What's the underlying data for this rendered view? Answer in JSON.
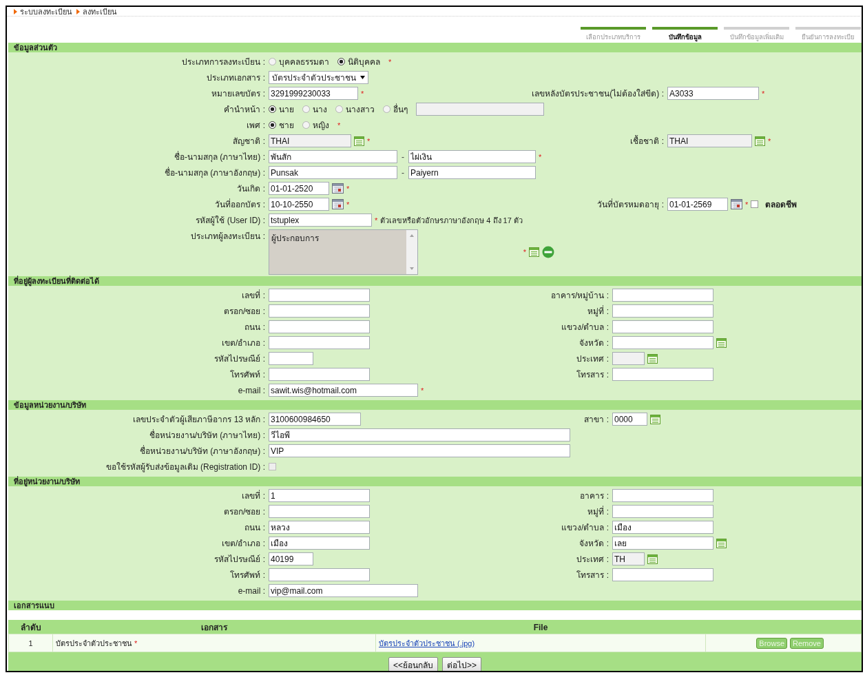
{
  "breadcrumb": [
    {
      "label": "ระบบลงทะเบียน"
    },
    {
      "label": "ลงทะเบียน"
    }
  ],
  "steps": [
    {
      "label": "เลือกประเภทบริการ",
      "done": true,
      "selected": false
    },
    {
      "label": "บันทึกข้อมูล",
      "done": true,
      "selected": true
    },
    {
      "label": "บันทึกข้อมูลเพิ่มเติม",
      "done": false,
      "selected": false
    },
    {
      "label": "ยืนยันการลงทะเบีย",
      "done": false,
      "selected": false
    }
  ],
  "sections": [
    {
      "kind": "personal",
      "title": "ข้อมูลส่วนตัว",
      "rows": [
        {
          "left": {
            "label": "ประเภทการลงทะเบียน :",
            "controls": [
              {
                "kind": "radio",
                "label": "บุคคลธรรมดา",
                "selected": false
              },
              {
                "kind": "radio",
                "label": "นิติบุคคล",
                "selected": true
              },
              {
                "kind": "required",
                "text": "*"
              }
            ]
          }
        },
        {
          "left": {
            "label": "ประเภทเอกสาร :",
            "controls": [
              {
                "kind": "select",
                "value": "บัตรประจำตัวประชาชน"
              }
            ]
          }
        },
        {
          "left": {
            "label": "หมายเลขบัตร :",
            "controls": [
              {
                "kind": "text",
                "value": "3291999230033"
              },
              {
                "kind": "required",
                "text": "*"
              }
            ]
          },
          "right": {
            "label": "เลขหลังบัตรประชาชน(ไม่ต้องใส่ขีด) :",
            "controls": [
              {
                "kind": "text",
                "value": "A3033"
              },
              {
                "kind": "required",
                "text": "*"
              }
            ]
          }
        },
        {
          "left": {
            "label": "คำนำหน้า :",
            "controls": [
              {
                "kind": "radio",
                "label": "นาย",
                "selected": true
              },
              {
                "kind": "radio",
                "label": "นาง",
                "selected": false
              },
              {
                "kind": "radio",
                "label": "นางสาว",
                "selected": false
              },
              {
                "kind": "radio",
                "label": "อื่นๆ",
                "selected": false
              },
              {
                "kind": "locked"
              }
            ]
          }
        },
        {
          "left": {
            "label": "เพศ :",
            "controls": [
              {
                "kind": "radio",
                "label": "ชาย",
                "selected": true
              },
              {
                "kind": "radio",
                "label": "หญิง",
                "selected": false
              },
              {
                "kind": "required",
                "text": "*"
              }
            ]
          }
        },
        {
          "left": {
            "label": "สัญชาติ :",
            "controls": [
              {
                "kind": "locked",
                "value": "THAI"
              },
              {
                "kind": "list"
              },
              {
                "kind": "required",
                "text": "*"
              }
            ]
          },
          "right": {
            "label": "เชื้อชาติ :",
            "controls": [
              {
                "kind": "locked",
                "value": "THAI"
              },
              {
                "kind": "list"
              },
              {
                "kind": "required",
                "text": "*"
              }
            ]
          }
        },
        {
          "left": {
            "label": "ชื่อ-นามสกุล (ภาษาไทย) :",
            "controls": [
              {
                "kind": "text",
                "value": "พันสัก"
              },
              {
                "kind": "separator",
                "text": "-"
              },
              {
                "kind": "text",
                "value": "ไผ่เงิน"
              },
              {
                "kind": "required",
                "text": "*"
              }
            ]
          }
        },
        {
          "left": {
            "label": "ชื่อ-นามสกุล (ภาษาอังกฤษ) :",
            "controls": [
              {
                "kind": "text",
                "value": "Punsak"
              },
              {
                "kind": "separator",
                "text": "-"
              },
              {
                "kind": "text",
                "value": "Paiyern"
              }
            ]
          }
        },
        {
          "left": {
            "label": "วันเกิด :",
            "controls": [
              {
                "kind": "text",
                "value": "01-01-2520"
              },
              {
                "kind": "calendar"
              },
              {
                "kind": "required",
                "text": "*"
              }
            ]
          }
        },
        {
          "left": {
            "label": "วันที่ออกบัตร :",
            "controls": [
              {
                "kind": "text",
                "value": "10-10-2550"
              },
              {
                "kind": "calendar"
              },
              {
                "kind": "required",
                "text": "*"
              }
            ]
          },
          "right": {
            "label": "วันที่บัตรหมดอายุ :",
            "controls": [
              {
                "kind": "text",
                "value": "01-01-2569"
              },
              {
                "kind": "calendar"
              },
              {
                "kind": "required",
                "text": "*"
              },
              {
                "kind": "checkbox",
                "label": "ตลอดชีพ",
                "checked": false,
                "disabled": false
              }
            ]
          }
        },
        {
          "left": {
            "label": "รหัสผู้ใช้ (User ID) :",
            "controls": [
              {
                "kind": "text",
                "value": "tstuplex"
              },
              {
                "kind": "required",
                "text": "*"
              },
              {
                "kind": "hint",
                "text": "ตัวเลขหรือตัวอักษรภาษาอังกฤษ 4 ถึง 17 ตัว"
              }
            ]
          }
        },
        {
          "left": {
            "label": "ประเภทผู้ลงทะเบียน :",
            "controls": [
              {
                "kind": "listbox",
                "value": "ผู้ประกอบการ"
              },
              {
                "kind": "required",
                "text": "*"
              },
              {
                "kind": "list"
              },
              {
                "kind": "remove"
              }
            ]
          }
        }
      ]
    },
    {
      "kind": "address",
      "title": "ที่อยู่ผู้ลงทะเบียนที่ติดต่อได้",
      "rows": [
        {
          "left": {
            "label": "เลขที่ :",
            "controls": [
              {
                "kind": "text"
              }
            ]
          },
          "right": {
            "label": "อาคาร/หมู่บ้าน :",
            "controls": [
              {
                "kind": "text"
              }
            ]
          }
        },
        {
          "left": {
            "label": "ตรอก/ซอย :",
            "controls": [
              {
                "kind": "text"
              }
            ]
          },
          "right": {
            "label": "หมู่ที่ :",
            "controls": [
              {
                "kind": "text"
              }
            ]
          }
        },
        {
          "left": {
            "label": "ถนน :",
            "controls": [
              {
                "kind": "text"
              }
            ]
          },
          "right": {
            "label": "แขวง/ตำบล :",
            "controls": [
              {
                "kind": "text"
              }
            ]
          }
        },
        {
          "left": {
            "label": "เขต/อำเภอ :",
            "controls": [
              {
                "kind": "text"
              }
            ]
          },
          "right": {
            "label": "จังหวัด :",
            "controls": [
              {
                "kind": "text"
              },
              {
                "kind": "list"
              }
            ]
          }
        },
        {
          "left": {
            "label": "รหัสไปรษณีย์ :",
            "controls": [
              {
                "kind": "text"
              }
            ]
          },
          "right": {
            "label": "ประเทศ :",
            "controls": [
              {
                "kind": "locked"
              },
              {
                "kind": "list"
              }
            ]
          }
        },
        {
          "left": {
            "label": "โทรศัพท์ :",
            "controls": [
              {
                "kind": "text"
              }
            ]
          },
          "right": {
            "label": "โทรสาร :",
            "controls": [
              {
                "kind": "text"
              }
            ]
          }
        },
        {
          "left": {
            "label": "e-mail :",
            "controls": [
              {
                "kind": "text",
                "value": "sawit.wis@hotmail.com"
              },
              {
                "kind": "required",
                "text": "*"
              }
            ]
          }
        }
      ]
    },
    {
      "kind": "company",
      "title": "ข้อมูลหน่วยงาน/บริษัท",
      "rows": [
        {
          "left": {
            "label": "เลขประจำตัวผู้เสียภาษีอากร 13 หลัก :",
            "controls": [
              {
                "kind": "text",
                "value": "3100600984650"
              }
            ]
          },
          "right": {
            "label": "สาขา :",
            "controls": [
              {
                "kind": "text",
                "value": "0000"
              },
              {
                "kind": "list"
              }
            ]
          }
        },
        {
          "left": {
            "label": "ชื่อหน่วยงาน/บริษัท (ภาษาไทย) :",
            "controls": [
              {
                "kind": "text",
                "value": "วีไอพี"
              }
            ]
          }
        },
        {
          "left": {
            "label": "ชื่อหน่วยงาน/บริษัท (ภาษาอังกฤษ) :",
            "controls": [
              {
                "kind": "text",
                "value": "VIP"
              }
            ]
          }
        },
        {
          "left": {
            "label": "ขอใช้รหัสผู้รับส่งข้อมูลเดิม (Registration ID) :",
            "controls": [
              {
                "kind": "checkbox",
                "checked": false,
                "disabled": true
              }
            ]
          }
        }
      ]
    },
    {
      "kind": "address",
      "title": "ที่อยู่หน่วยงาน/บริษัท",
      "rows": [
        {
          "left": {
            "label": "เลขที่ :",
            "controls": [
              {
                "kind": "text",
                "value": "1"
              }
            ]
          },
          "right": {
            "label": "อาคาร :",
            "controls": [
              {
                "kind": "text"
              }
            ]
          }
        },
        {
          "left": {
            "label": "ตรอก/ซอย :",
            "controls": [
              {
                "kind": "text"
              }
            ]
          },
          "right": {
            "label": "หมู่ที่ :",
            "controls": [
              {
                "kind": "text"
              }
            ]
          }
        },
        {
          "left": {
            "label": "ถนน :",
            "controls": [
              {
                "kind": "text",
                "value": "หลวง"
              }
            ]
          },
          "right": {
            "label": "แขวง/ตำบล :",
            "controls": [
              {
                "kind": "text",
                "value": "เมือง"
              }
            ]
          }
        },
        {
          "left": {
            "label": "เขต/อำเภอ :",
            "controls": [
              {
                "kind": "text",
                "value": "เมือง"
              }
            ]
          },
          "right": {
            "label": "จังหวัด :",
            "controls": [
              {
                "kind": "text",
                "value": "เลย"
              },
              {
                "kind": "list"
              }
            ]
          }
        },
        {
          "left": {
            "label": "รหัสไปรษณีย์ :",
            "controls": [
              {
                "kind": "text",
                "value": "40199"
              }
            ]
          },
          "right": {
            "label": "ประเทศ :",
            "controls": [
              {
                "kind": "locked",
                "value": "TH"
              },
              {
                "kind": "list"
              }
            ]
          }
        },
        {
          "left": {
            "label": "โทรศัพท์ :",
            "controls": [
              {
                "kind": "text"
              }
            ]
          },
          "right": {
            "label": "โทรสาร :",
            "controls": [
              {
                "kind": "text"
              }
            ]
          }
        },
        {
          "left": {
            "label": "e-mail :",
            "controls": [
              {
                "kind": "text",
                "value": "vip@mail.com"
              }
            ]
          }
        }
      ]
    },
    {
      "kind": "attachments",
      "title": "เอกสารแนบ",
      "table": {
        "columns": [
          "ลำดับ",
          "เอกสาร",
          "File"
        ],
        "rows": [
          {
            "no": "1",
            "document": "บัตรประจำตัวประชาชน",
            "required_mark": "*",
            "file": "บัตรประจำตัวประชาชน (.jpg)",
            "buttons": [
              {
                "label": "Browse",
                "disabled": true
              },
              {
                "label": "Remove",
                "disabled": true
              }
            ]
          }
        ]
      }
    }
  ],
  "nav_buttons": [
    "<<ย้อนกลับ",
    "ต่อไป>>"
  ]
}
